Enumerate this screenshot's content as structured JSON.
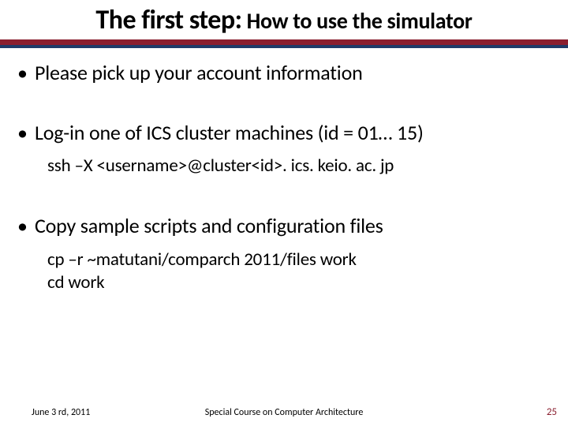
{
  "title": {
    "strong": "The first step:",
    "rest": " How to use the simulator"
  },
  "bullets": {
    "b1": "Please pick up your account information",
    "b2": "Log-in one of ICS cluster machines (id = 01… 15)",
    "b2_sub": "ssh –X <username>@cluster<id>. ics. keio. ac. jp",
    "b3": "Copy sample scripts and configuration files",
    "b3_sub1": "cp –r ~matutani/comparch 2011/files work",
    "b3_sub2": "cd work"
  },
  "footer": {
    "date": "June 3 rd, 2011",
    "center": "Special Course on Computer Architecture",
    "page": "25"
  },
  "glyphs": {
    "bullet": "•"
  }
}
